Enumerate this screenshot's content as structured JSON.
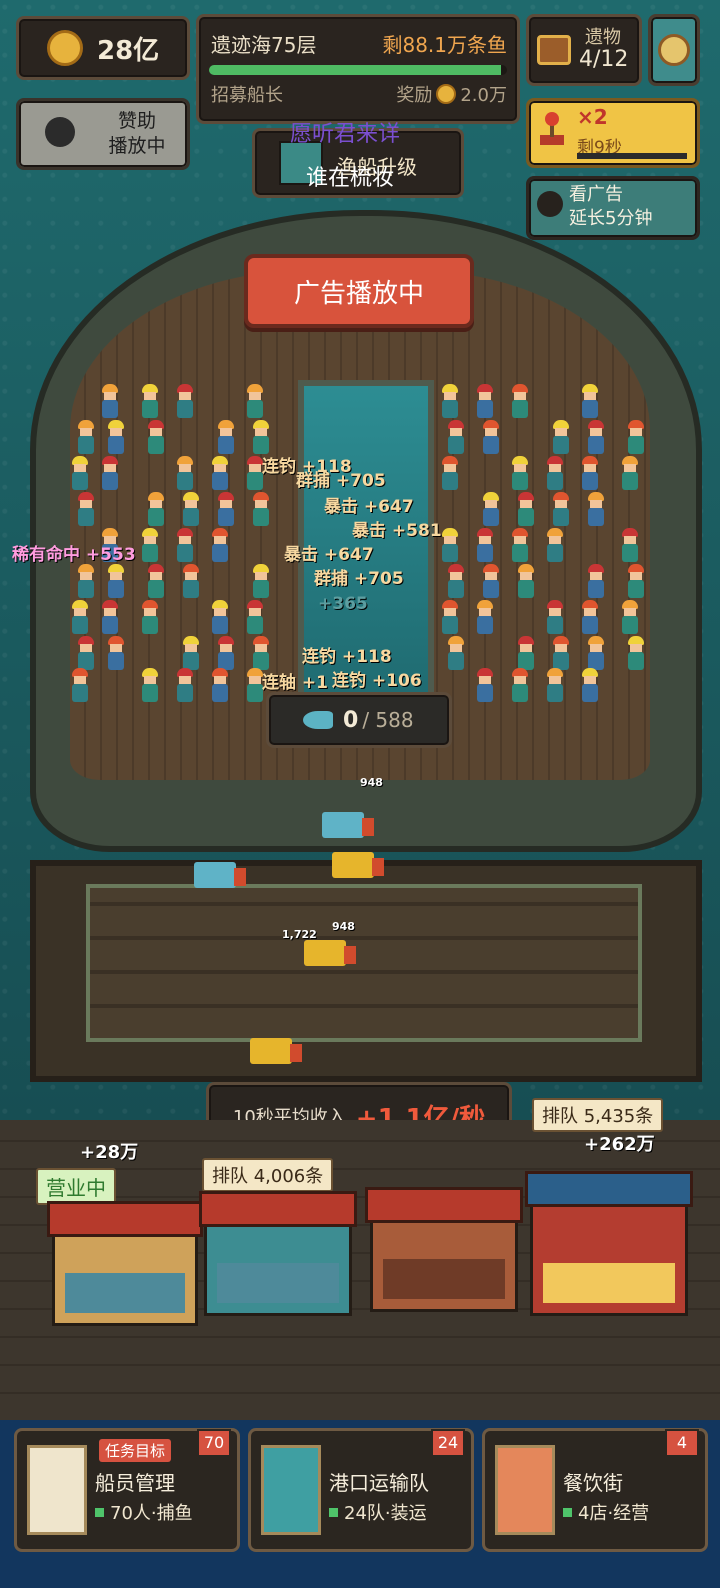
{
  "top": {
    "coins": "28亿",
    "stage_title": "遗迹海75层",
    "stage_remaining": "剩88.1万条鱼",
    "stage_progress": 0.98,
    "recruit_label": "招募船长",
    "reward_label": "奖励",
    "reward_value": "2.0万",
    "relic_label": "遗物",
    "relic_count": "4/12"
  },
  "sponsor": {
    "line1": "赞助",
    "line2": "播放中"
  },
  "multiplier": {
    "value": "×2",
    "remaining": "剩9秒"
  },
  "ad_extend": {
    "line1": "看广告",
    "line2": "延长5分钟"
  },
  "upgrade": {
    "label": "渔船升级"
  },
  "overlay": {
    "line1": "愿听君来详",
    "line2": "谁在梳妆"
  },
  "ad_banner": "广告播放中",
  "floating_texts": [
    "连钓 +118",
    "群捕 +705",
    "暴击 +647",
    "暴击 +581",
    "稀有命中 +553",
    "暴击 +647",
    "群捕 +705",
    "+365",
    "连钓 +118",
    "连轴 +1",
    "连钓 +106"
  ],
  "catch": {
    "current": "0",
    "max": "/ 588"
  },
  "trucks": {
    "count_a": "948",
    "count_b": "1,722",
    "count_c": "948"
  },
  "income": {
    "label": "10秒平均收入",
    "value": "+1.1亿/秒"
  },
  "shops": {
    "shop1_status": "营业中",
    "shop1_plus": "+28万",
    "shop2_queue": "排队 4,006条",
    "shop4_queue": "排队 5,435条",
    "shop4_plus": "+262万"
  },
  "cards": [
    {
      "title": "船员管理",
      "sub": "70人·捕鱼",
      "badge": "70",
      "tag": "任务目标"
    },
    {
      "title": "港口运输队",
      "sub": "24队·装运",
      "badge": "24"
    },
    {
      "title": "餐饮街",
      "sub": "4店·经营",
      "badge": "4"
    }
  ],
  "colors": {
    "sea": "#1f6a6d",
    "accent_red": "#d8533c",
    "gold": "#e7b33d",
    "bottom_bar": "#12365e"
  }
}
